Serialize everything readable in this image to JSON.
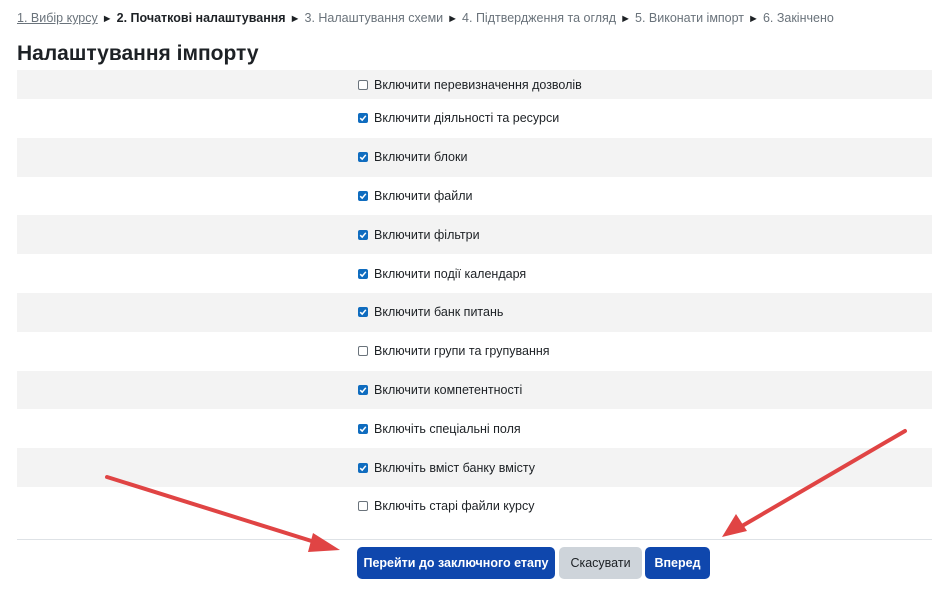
{
  "breadcrumb": {
    "steps": [
      "1. Вибір курсу",
      "2. Початкові налаштування",
      "3. Налаштування схеми",
      "4. Підтвердження та огляд",
      "5. Виконати імпорт",
      "6. Закінчено"
    ],
    "separator": "►"
  },
  "page": {
    "title": "Налаштування імпорту"
  },
  "settings": {
    "items": [
      {
        "label": "Включити перевизначення дозволів",
        "checked": false
      },
      {
        "label": "Включити діяльності та ресурси",
        "checked": true
      },
      {
        "label": "Включити блоки",
        "checked": true
      },
      {
        "label": "Включити файли",
        "checked": true
      },
      {
        "label": "Включити фільтри",
        "checked": true
      },
      {
        "label": "Включити події календаря",
        "checked": true
      },
      {
        "label": "Включити банк питань",
        "checked": true
      },
      {
        "label": "Включити групи та групування",
        "checked": false
      },
      {
        "label": "Включити компетентності",
        "checked": true
      },
      {
        "label": "Включіть спеціальні поля",
        "checked": true
      },
      {
        "label": "Включіть вміст банку вмісту",
        "checked": true
      },
      {
        "label": "Включіть старі файли курсу",
        "checked": false
      }
    ]
  },
  "actions": {
    "final_step_label": "Перейти до заключного етапу",
    "cancel_label": "Скасувати",
    "next_label": "Вперед"
  },
  "colors": {
    "primary": "#0f47ad",
    "checkbox": "#0f6cbf",
    "secondary": "#ced4da",
    "annotation_arrow": "#e04444"
  }
}
